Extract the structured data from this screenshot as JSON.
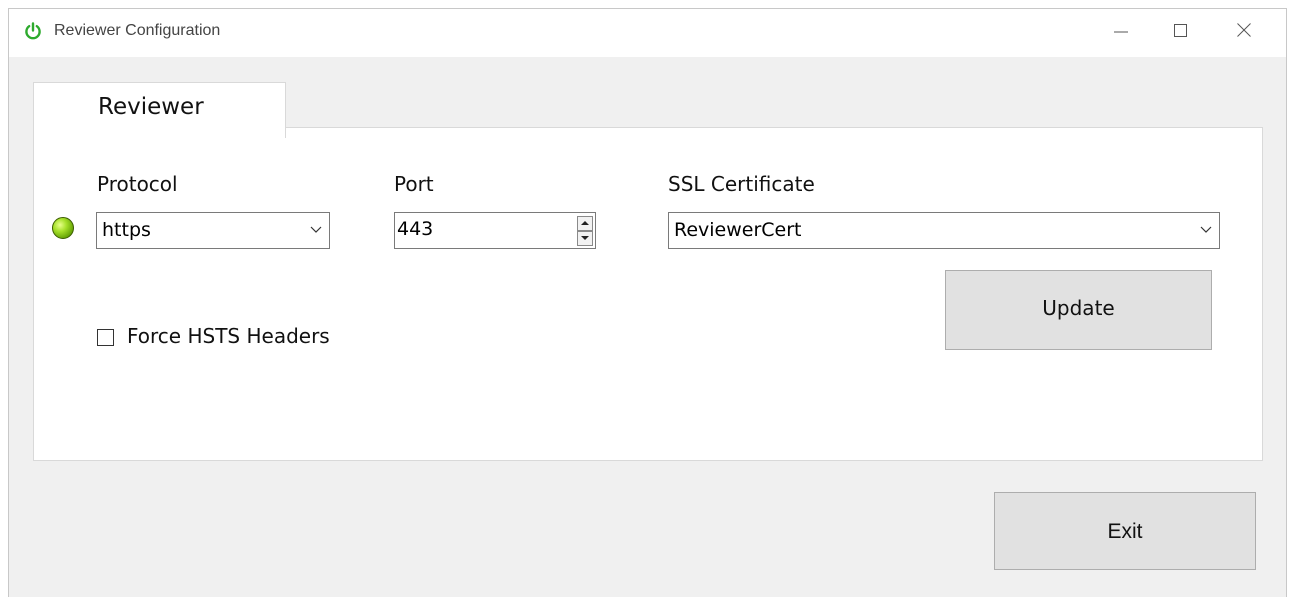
{
  "window": {
    "title": "Reviewer Configuration",
    "icon": "power-icon",
    "accent_color": "#2eaa2e"
  },
  "tabs": [
    {
      "label": "Reviewer",
      "selected": true
    }
  ],
  "form": {
    "status_led_color": "#7cc510",
    "protocol": {
      "label": "Protocol",
      "value": "https"
    },
    "port": {
      "label": "Port",
      "value": "443"
    },
    "ssl_certificate": {
      "label": "SSL Certificate",
      "value": "ReviewerCert"
    },
    "force_hsts": {
      "label": "Force HSTS Headers",
      "checked": false
    },
    "update_label": "Update"
  },
  "footer": {
    "exit_label": "Exit"
  }
}
